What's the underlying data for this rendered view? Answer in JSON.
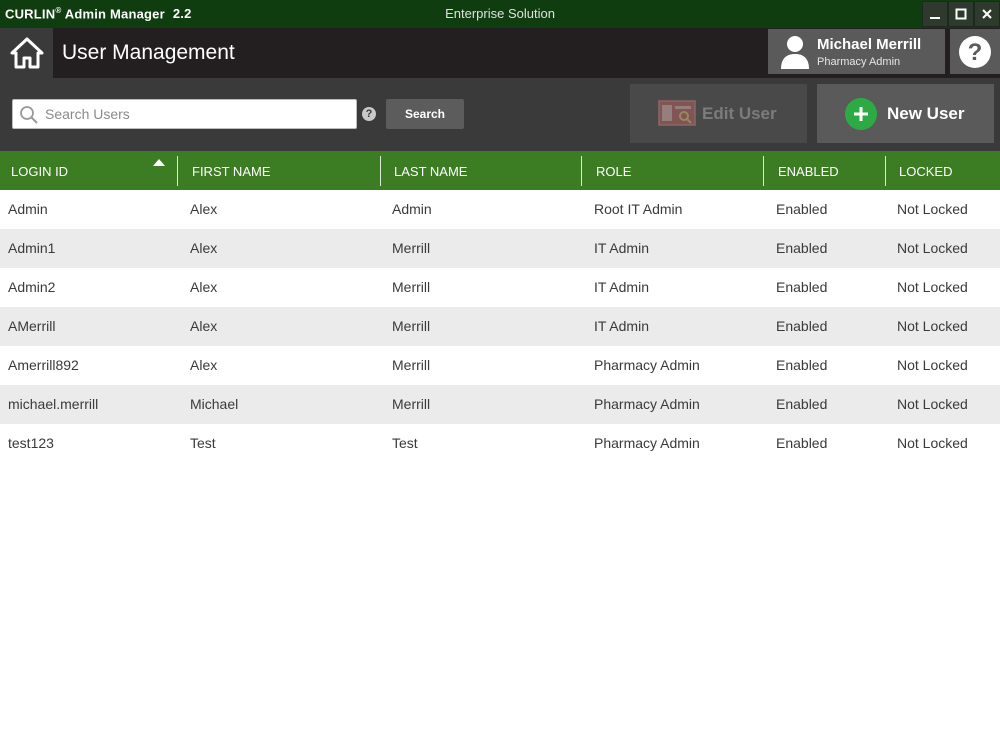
{
  "titlebar": {
    "app_name": "CURLIN",
    "reg_mark": "®",
    "app_rest": " Admin Manager",
    "version": "2.2",
    "center_title": "Enterprise Solution"
  },
  "header": {
    "page_title": "User Management",
    "user_name": "Michael Merrill",
    "user_role": "Pharmacy Admin"
  },
  "toolbar": {
    "search_placeholder": "Search Users",
    "search_value": "",
    "help_glyph": "?",
    "search_label": "Search",
    "edit_label": "Edit User",
    "new_label": "New User"
  },
  "table": {
    "sort_column": "LOGIN ID",
    "sort_direction": "ascending",
    "columns": [
      "LOGIN ID",
      "FIRST NAME",
      "LAST NAME",
      "ROLE",
      "ENABLED",
      "LOCKED"
    ],
    "rows": [
      [
        "Admin",
        "Alex",
        "Admin",
        "Root IT Admin",
        "Enabled",
        "Not Locked"
      ],
      [
        "Admin1",
        "Alex",
        "Merrill",
        "IT Admin",
        "Enabled",
        "Not Locked"
      ],
      [
        "Admin2",
        "Alex",
        "Merrill",
        "IT Admin",
        "Enabled",
        "Not Locked"
      ],
      [
        "AMerrill",
        "Alex",
        "Merrill",
        "IT Admin",
        "Enabled",
        "Not Locked"
      ],
      [
        "Amerrill892",
        "Alex",
        "Merrill",
        "Pharmacy Admin",
        "Enabled",
        "Not Locked"
      ],
      [
        "michael.merrill",
        "Michael",
        "Merrill",
        "Pharmacy Admin",
        "Enabled",
        "Not Locked"
      ],
      [
        "test123",
        "Test",
        "Test",
        "Pharmacy Admin",
        "Enabled",
        "Not Locked"
      ]
    ]
  },
  "colors": {
    "titlebar_bg": "#0f3d0f",
    "header_bg": "#231f20",
    "toolbar_bg": "#3a3a3a",
    "table_header_bg": "#3c7d23",
    "new_user_accent": "#2eaa45",
    "row_alt_bg": "#ebebeb"
  },
  "icons": {
    "home": "home-icon",
    "avatar": "user-avatar-icon",
    "help": "help-icon",
    "search": "search-icon",
    "edit": "edit-user-icon",
    "new": "plus-circle-icon",
    "sort": "sort-ascending-icon"
  }
}
